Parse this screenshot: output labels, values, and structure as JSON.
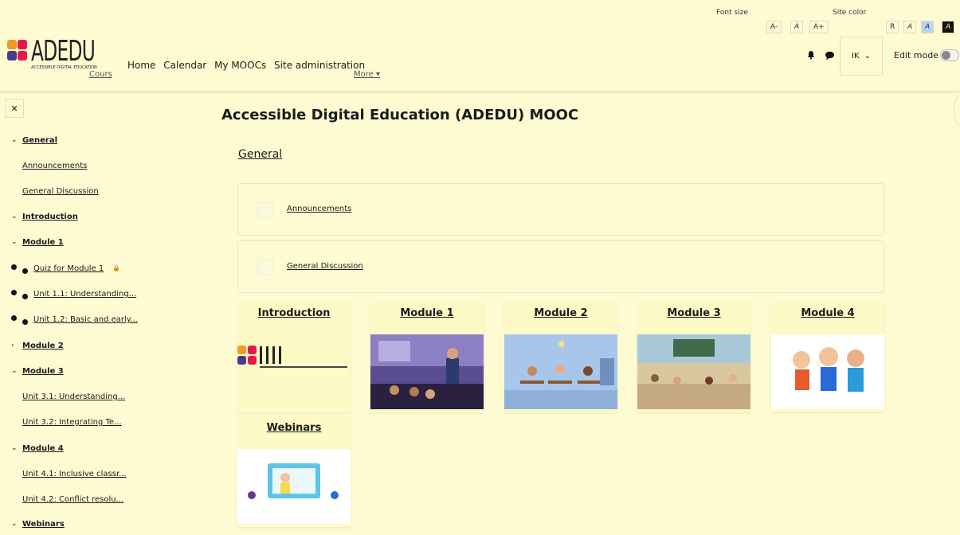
{
  "header": {
    "logo": {
      "wordmark": "ADEDU",
      "tagline": "ACCESSIBLE DIGITAL EDUCATION"
    },
    "nav": [
      "Home",
      "Calendar",
      "My MOOCs",
      "Site administration"
    ],
    "nav_overflow": {
      "courses": "Cours",
      "more": "More ▾"
    },
    "font_size": {
      "label": "Font size",
      "buttons": [
        "A-",
        "A",
        "A+"
      ]
    },
    "site_color": {
      "label": "Site color",
      "buttons": [
        "R",
        "A",
        "A",
        "A"
      ]
    },
    "user_initials": "IK",
    "edit_mode_label": "Edit mode"
  },
  "drawer": {
    "items": [
      {
        "kind": "section",
        "icon": "chevron-down",
        "label": "General"
      },
      {
        "kind": "sub",
        "label": "Announcements"
      },
      {
        "kind": "sub",
        "label": "General Discussion"
      },
      {
        "kind": "section",
        "icon": "chevron-down",
        "label": "Introduction"
      },
      {
        "kind": "section",
        "icon": "chevron-down",
        "label": "Module 1"
      },
      {
        "kind": "dot",
        "label": "Quiz for Module 1",
        "locked": true
      },
      {
        "kind": "dot",
        "label": "Unit 1.1: Understanding..."
      },
      {
        "kind": "dot",
        "label": "Unit 1.2: Basic and early..."
      },
      {
        "kind": "section",
        "icon": "chevron-right",
        "label": "Module 2"
      },
      {
        "kind": "section",
        "icon": "chevron-down",
        "label": "Module 3"
      },
      {
        "kind": "sub",
        "label": "Unit 3.1: Understanding..."
      },
      {
        "kind": "sub",
        "label": "Unit 3.2: Integrating Te..."
      },
      {
        "kind": "section",
        "icon": "chevron-down",
        "label": "Module 4"
      },
      {
        "kind": "sub",
        "label": "Unit 4.1: Inclusive classr..."
      },
      {
        "kind": "sub",
        "label": "Unit 4.2: Conflict resolu..."
      },
      {
        "kind": "section",
        "icon": "chevron-down",
        "label": "Webinars"
      }
    ]
  },
  "main": {
    "course_title": "Accessible Digital Education (ADEDU) MOOC",
    "section_title": "General",
    "activities": [
      "Announcements",
      "General Discussion"
    ],
    "cards": [
      "Introduction",
      "Module 1",
      "Module 2",
      "Module 3",
      "Module 4",
      "Webinars"
    ]
  },
  "colors": {
    "background": "#fefbd2",
    "text": "#1b1b1b",
    "accent_blue": "#b5d6f2"
  }
}
